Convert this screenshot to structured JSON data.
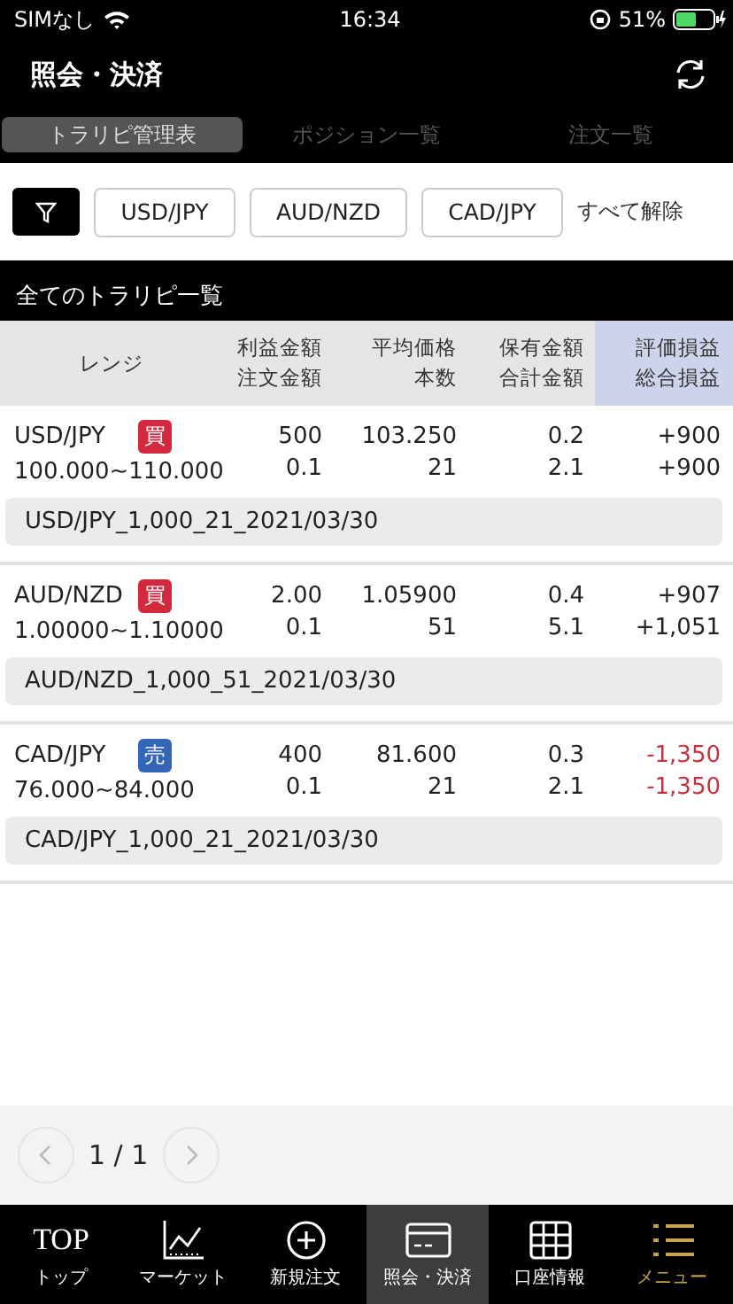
{
  "status_bar": {
    "carrier": "SIMなし",
    "time": "16:34",
    "battery": "51%"
  },
  "header": {
    "title": "照会・決済"
  },
  "tabs": [
    {
      "label": "トラリピ管理表",
      "selected": true
    },
    {
      "label": "ポジション一覧",
      "selected": false
    },
    {
      "label": "注文一覧",
      "selected": false
    }
  ],
  "filters": {
    "chips": [
      "USD/JPY",
      "AUD/NZD",
      "CAD/JPY"
    ],
    "clear": "すべて解除"
  },
  "section_title": "全てのトラリピ一覧",
  "table": {
    "columns": [
      {
        "top": "レンジ"
      },
      {
        "top": "利益金額",
        "bottom": "注文金額"
      },
      {
        "top": "平均価格",
        "bottom": "本数"
      },
      {
        "top": "保有金額",
        "bottom": "合計金額"
      },
      {
        "top": "評価損益",
        "bottom": "総合損益",
        "highlight": true
      }
    ],
    "rows": [
      {
        "pair": "USD/JPY",
        "kind": "buy",
        "badge": "買",
        "range": "100.000~110.000",
        "profit": "500",
        "order": "0.1",
        "avg": "103.250",
        "count": "21",
        "held": "0.2",
        "total": "2.1",
        "eval": "+900",
        "overall": "+900",
        "loss": false,
        "name": "USD/JPY_1,000_21_2021/03/30"
      },
      {
        "pair": "AUD/NZD",
        "kind": "buy",
        "badge": "買",
        "range": "1.00000~1.10000",
        "profit": "2.00",
        "order": "0.1",
        "avg": "1.05900",
        "count": "51",
        "held": "0.4",
        "total": "5.1",
        "eval": "+907",
        "overall": "+1,051",
        "loss": false,
        "name": "AUD/NZD_1,000_51_2021/03/30"
      },
      {
        "pair": "CAD/JPY",
        "kind": "sell",
        "badge": "売",
        "range": "76.000~84.000",
        "profit": "400",
        "order": "0.1",
        "avg": "81.600",
        "count": "21",
        "held": "0.3",
        "total": "2.1",
        "eval": "-1,350",
        "overall": "-1,350",
        "loss": true,
        "name": "CAD/JPY_1,000_21_2021/03/30"
      }
    ]
  },
  "pagination": {
    "page": "1 / 1"
  },
  "nav": [
    {
      "kind": "text",
      "icon_text": "TOP",
      "label": "トップ",
      "selected": false,
      "accent": false
    },
    {
      "kind": "chart",
      "label": "マーケット",
      "selected": false,
      "accent": false
    },
    {
      "kind": "plus",
      "label": "新規注文",
      "selected": false,
      "accent": false
    },
    {
      "kind": "card",
      "label": "照会・決済",
      "selected": true,
      "accent": false
    },
    {
      "kind": "grid",
      "label": "口座情報",
      "selected": false,
      "accent": false
    },
    {
      "kind": "list",
      "label": "メニュー",
      "selected": false,
      "accent": true
    }
  ]
}
